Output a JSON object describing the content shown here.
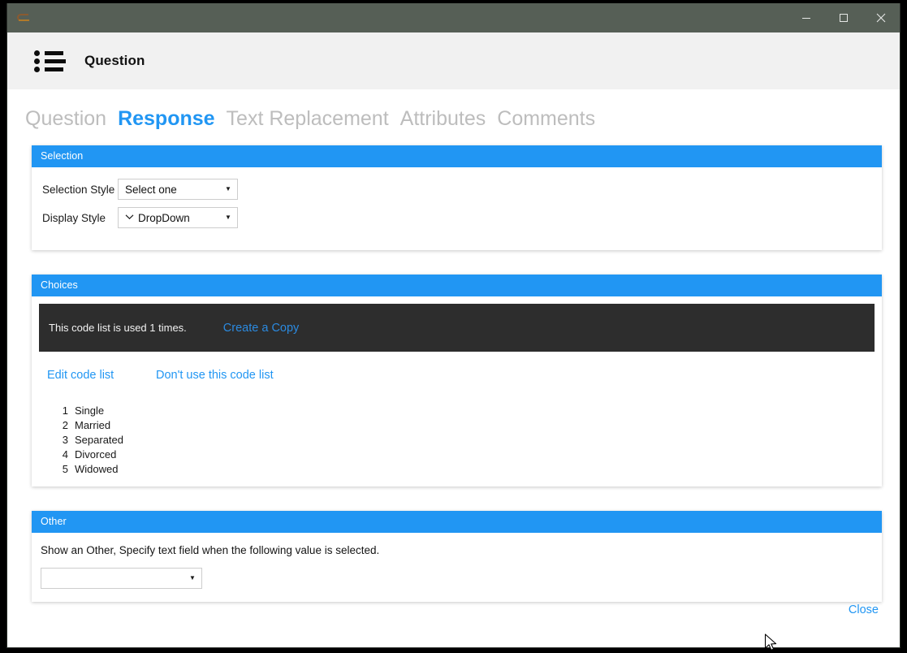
{
  "window": {
    "app_icon": "app-bracket-icon",
    "title": "",
    "controls": {
      "minimize": "minimize-icon",
      "maximize": "maximize-icon",
      "close": "close-icon"
    }
  },
  "header": {
    "icon": "bulleted-list-icon",
    "title": "Question"
  },
  "tabs": [
    {
      "label": "Question",
      "active": false
    },
    {
      "label": "Response",
      "active": true
    },
    {
      "label": "Text Replacement",
      "active": false
    },
    {
      "label": "Attributes",
      "active": false
    },
    {
      "label": "Comments",
      "active": false
    }
  ],
  "selection_panel": {
    "title": "Selection",
    "fields": [
      {
        "label": "Selection Style",
        "value": "Select one",
        "has_leading_chevron": false,
        "arrow_icon": "triangle-down-icon"
      },
      {
        "label": "Display Style",
        "value": "DropDown",
        "has_leading_chevron": true,
        "leading_icon": "chevron-down-icon",
        "arrow_icon": "triangle-down-icon"
      }
    ]
  },
  "choices_panel": {
    "title": "Choices",
    "usage_text": "This code list is used 1 times.",
    "create_copy_label": "Create a Copy",
    "edit_codelist_label": "Edit code list",
    "dont_use_codelist_label": "Don't use this code list",
    "codes": [
      {
        "code": "1",
        "label": "Single"
      },
      {
        "code": "2",
        "label": "Married"
      },
      {
        "code": "3",
        "label": "Separated"
      },
      {
        "code": "4",
        "label": "Divorced"
      },
      {
        "code": "5",
        "label": "Widowed"
      }
    ]
  },
  "other_panel": {
    "title": "Other",
    "description": "Show an Other, Specify text field when the following value is selected.",
    "select_value": "",
    "select_placeholder": "",
    "arrow_icon": "triangle-down-icon"
  },
  "footer": {
    "close_label": "Close"
  },
  "colors": {
    "accent_blue": "#2196f3",
    "titlebar": "#565f56",
    "header_band": "#f1f1f1",
    "dark_bar": "#2d2d2d",
    "tab_inactive": "#bdbdbd"
  }
}
